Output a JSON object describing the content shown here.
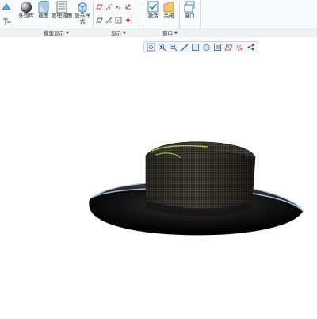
{
  "ribbon": {
    "buttons": {
      "appearance": "外观库",
      "section": "截面",
      "manage_views": "管理视图",
      "display_style_line1": "显示样",
      "display_style_line2": "式",
      "activate": "激活",
      "close": "关闭",
      "window": "窗口"
    },
    "groups": {
      "model_display": "模型显示",
      "show": "显示",
      "window": "窗口"
    }
  },
  "colors": {
    "ribbon_bg": "#f9fafc",
    "group_bar_bg": "#eef1f6",
    "hat_dark": "#0d0d0d",
    "hat_mesh": "#5b5346",
    "highlight_curve": "#b6d334"
  },
  "icons": {
    "view_toolbar": [
      "refit-icon",
      "zoom-in-icon",
      "zoom-out-icon",
      "repaint-icon",
      "display-style-icon",
      "saved-orientations-icon",
      "view-manager-icon",
      "datum-display-icon",
      "annotation-display-icon",
      "spin-center-icon"
    ]
  }
}
